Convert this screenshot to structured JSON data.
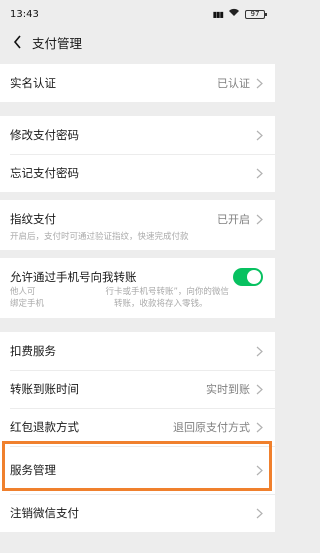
{
  "status_bar": {
    "time": "13:43",
    "battery": "97"
  },
  "nav": {
    "title": "支付管理"
  },
  "items": {
    "real_name": {
      "label": "实名认证",
      "value": "已认证"
    },
    "modify_password": {
      "label": "修改支付密码"
    },
    "forgot_password": {
      "label": "忘记支付密码"
    },
    "fingerprint": {
      "label": "指纹支付",
      "value": "已开启",
      "hint": "开启后，支付时可通过验证指纹，快速完成付款"
    },
    "phone_transfer": {
      "label": "允许通过手机号向我转账",
      "hint_line1": "他人可",
      "hint_line1b": "行卡或手机号转账”，向你的微信",
      "hint_line2": "绑定手机",
      "hint_line2b": "转账，收款将存入零钱。"
    },
    "deduction": {
      "label": "扣费服务"
    },
    "arrival_time": {
      "label": "转账到账时间",
      "value": "实时到账"
    },
    "refund_method": {
      "label": "红包退款方式",
      "value": "退回原支付方式"
    },
    "service_mgmt": {
      "label": "服务管理"
    },
    "cancel_wechat_pay": {
      "label": "注销微信支付"
    }
  },
  "colors": {
    "toggle_on": "#07c160",
    "highlight": "#f0802d"
  },
  "toggle_state": {
    "phone_transfer": true
  }
}
